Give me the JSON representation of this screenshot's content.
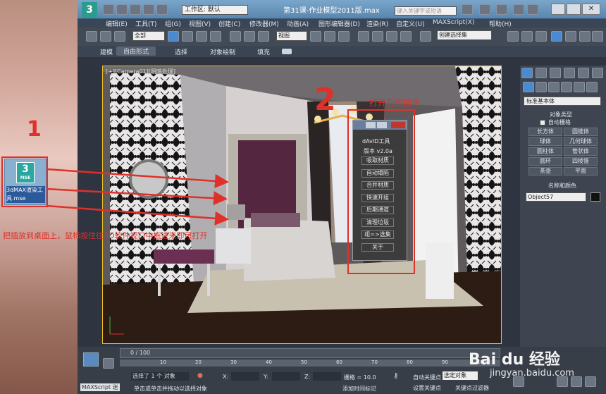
{
  "app": {
    "title": "第31课-作业模型2011版.max",
    "workspace": "工作区: 默认",
    "search_placeholder": "键入关键字或短语"
  },
  "menu": [
    "编辑(E)",
    "工具(T)",
    "组(G)",
    "视图(V)",
    "创建(C)",
    "修改器(M)",
    "动画(A)",
    "图形编辑器(D)",
    "渲染(R)",
    "自定义(U)",
    "MAXScript(X)",
    "帮助(H)"
  ],
  "toolbar": {
    "filter": "全部",
    "ref_coord": "视图",
    "selection_set": "创建选择集"
  },
  "ribbon_tabs": [
    "建模",
    "自由形式",
    "选择",
    "对象绘制",
    "填充"
  ],
  "desktop_icon": {
    "badge": "3",
    "sub": "MSE",
    "label": "3dMAX渲染工具.mse"
  },
  "viewport": {
    "label": "[+][Camera01][明暗处理]"
  },
  "annotations": {
    "num1": "1",
    "num2": "2",
    "after_open": "打开后的插件",
    "instruction": "把插放到桌面上，鼠标按住往3D软件视口中拖进来即可打开"
  },
  "dialog": {
    "title": "dAvID工具",
    "version": "版本 v2.0a",
    "buttons": [
      "吸取材质",
      "自动塌陷",
      "合并材质",
      "快速开组",
      "后期通道",
      "清理垃圾",
      "组=>选集",
      "关于"
    ]
  },
  "command_panel": {
    "dropdown": "标准基本体",
    "rollout_type": "对象类型",
    "autogrid": "自动栅格",
    "objects": [
      "长方体",
      "圆锥体",
      "球体",
      "几何球体",
      "圆柱体",
      "管状体",
      "圆环",
      "四棱锥",
      "茶壶",
      "平面"
    ],
    "rollout_name": "名称和颜色",
    "object_name": "Object57"
  },
  "timeline": {
    "frame": "0 / 100",
    "ticks": [
      "0",
      "10",
      "20",
      "30",
      "40",
      "50",
      "60",
      "70",
      "80",
      "90",
      "100"
    ]
  },
  "status": {
    "selected": "选择了 1 个 对象",
    "prompt": "单击或单击并拖动以选择对象",
    "maxscript": "MAXScript 迷",
    "x_label": "X:",
    "y_label": "Y:",
    "z_label": "Z:",
    "grid": "栅格 = 10.0",
    "autokey": "自动关键点",
    "setkey": "设置关键点",
    "sel_obj": "选定对象",
    "key_filter": "关键点过滤器",
    "add_time": "添加时间标记"
  },
  "watermark": {
    "brand": "Bai du 经验",
    "url": "jingyan.baidu.com"
  }
}
